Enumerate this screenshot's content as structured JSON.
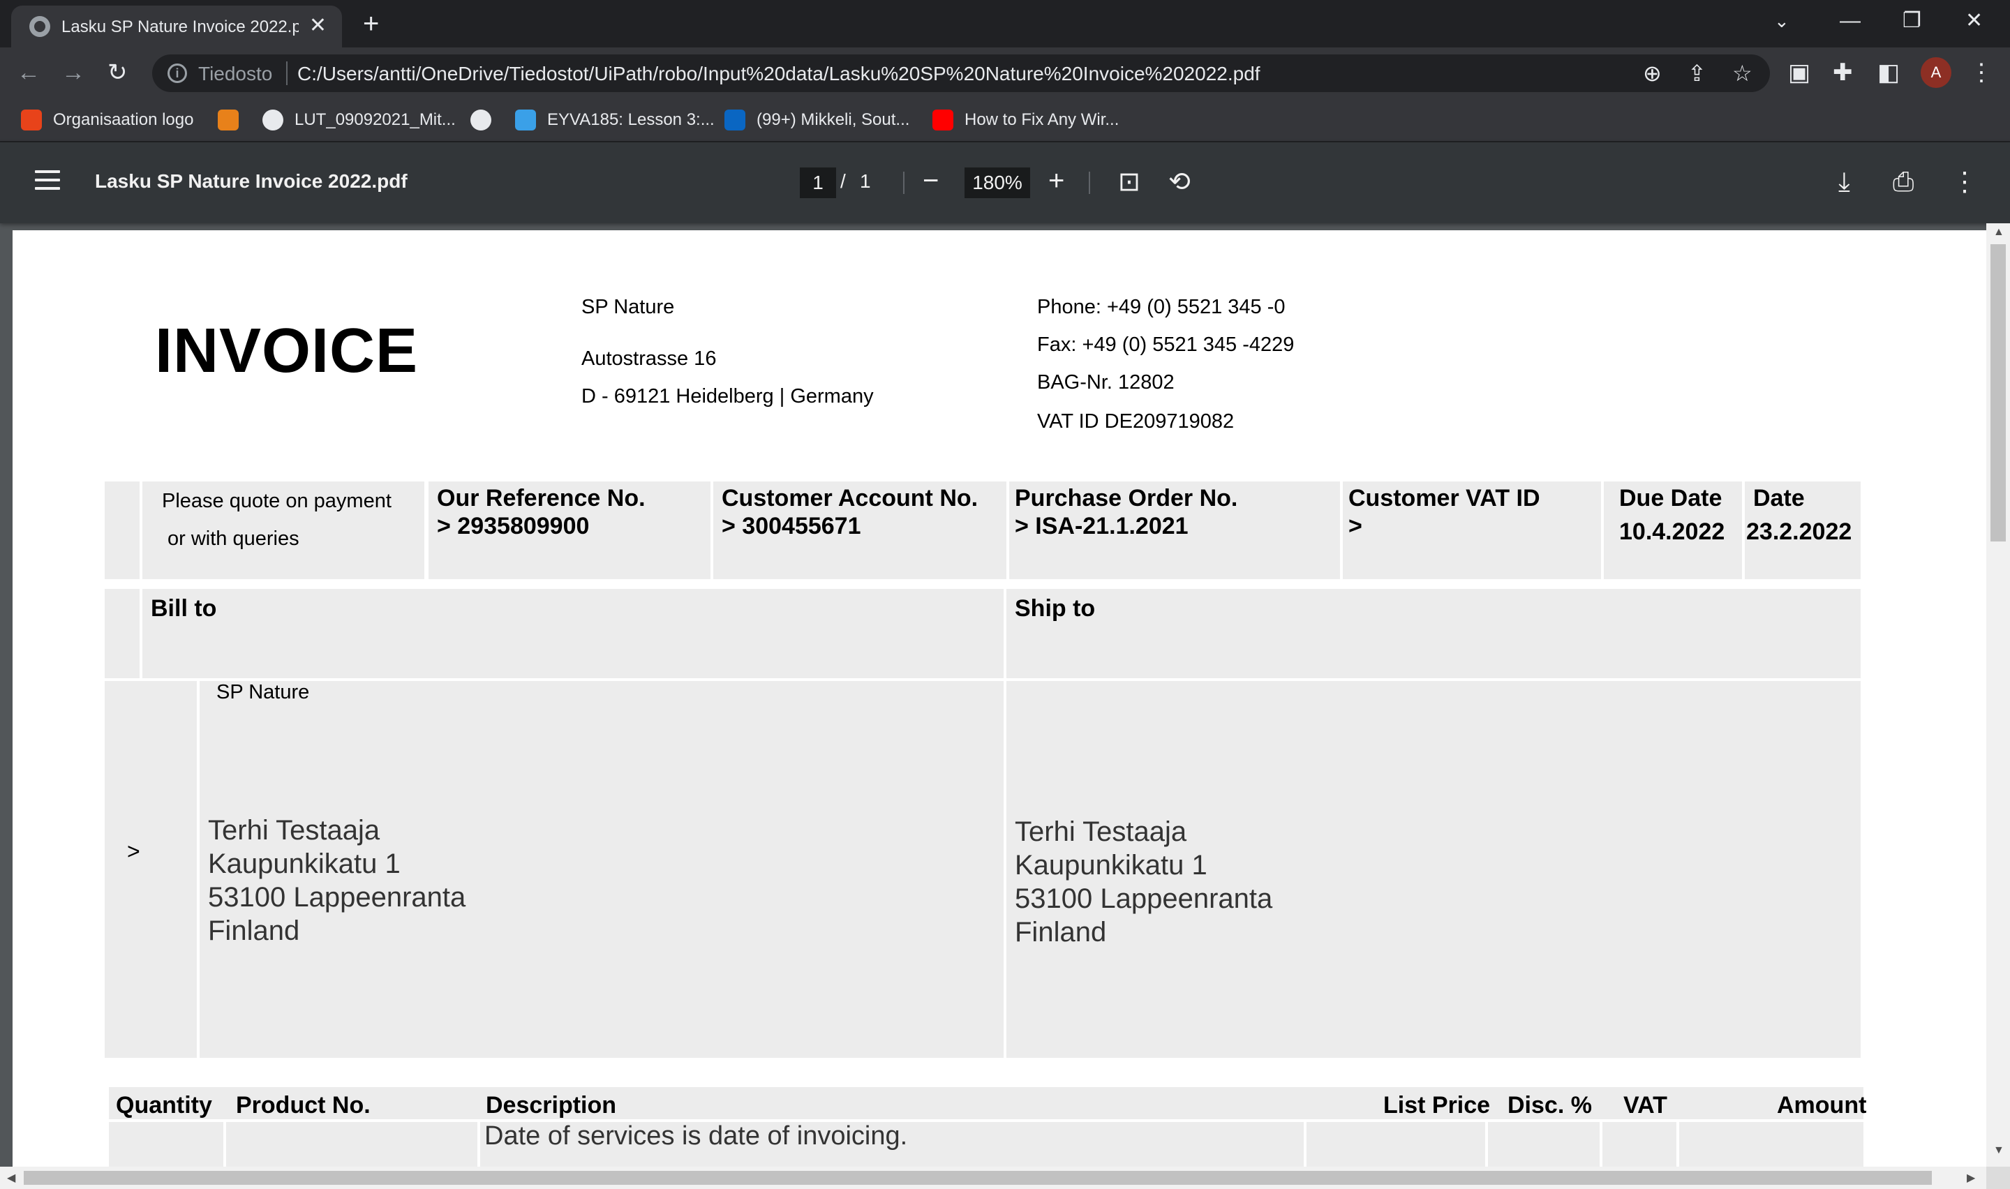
{
  "browser": {
    "tab_title": "Lasku SP Nature Invoice 2022.pdf",
    "tab_close": "✕",
    "new_tab": "+",
    "minimize": "—",
    "restore": "❐",
    "close": "✕",
    "back": "←",
    "forward": "→",
    "reload": "↻",
    "info_glyph": "i",
    "url_scheme": "Tiedosto",
    "url": "C:/Users/antti/OneDrive/Tiedostot/UiPath/robo/Input%20data/Lasku%20SP%20Nature%20Invoice%202022.pdf",
    "avatar_initial": "A",
    "icons": [
      "zoom-icon",
      "share-icon",
      "star-icon",
      "extension-icon",
      "puzzle-icon",
      "sidepanel-icon",
      "kebab-icon"
    ]
  },
  "bookmarks": [
    {
      "label": "Organisaation logo",
      "color": "#e8431a"
    },
    {
      "label": "",
      "color": "#e8811a"
    },
    {
      "label": "LUT_09092021_Mit...",
      "color": "#e8eaed"
    },
    {
      "label": "",
      "color": "#e8eaed"
    },
    {
      "label": "EYVA185: Lesson 3:...",
      "color": "#3aa0e8"
    },
    {
      "label": "(99+) Mikkeli, Sout...",
      "color": "#0a66c2"
    },
    {
      "label": "How to Fix Any Wir...",
      "color": "#ff0000"
    }
  ],
  "pdf_toolbar": {
    "title": "Lasku SP Nature Invoice 2022.pdf",
    "page_current": "1",
    "page_sep": "/",
    "page_total": "1",
    "zoom_out": "−",
    "zoom": "180%",
    "zoom_in": "+",
    "fit_icon": "⊡",
    "rotate_icon": "⟲",
    "download_icon": "⤓",
    "print_icon": "⎙",
    "more_icon": "⋮"
  },
  "invoice": {
    "title": "INVOICE",
    "company": {
      "name": "SP Nature",
      "street": "Autostrasse 16",
      "city": "D - 69121 Heidelberg | Germany"
    },
    "contact": {
      "phone": "Phone: +49 (0) 5521 345 -0",
      "fax": "Fax: +49 (0) 5521 345 -4229",
      "bag": "BAG-Nr. 12802",
      "vat": "VAT ID DE209719082"
    },
    "reference_row": {
      "quote_line1": "Please quote on payment",
      "quote_line2": "or with queries",
      "our_ref_label": "Our Reference No.",
      "our_ref_value": "> 2935809900",
      "cust_account_label": "Customer Account No.",
      "cust_account_value": "> 300455671",
      "po_label": "Purchase Order No.",
      "po_value": "> ISA-21.1.2021",
      "cust_vat_label": "Customer VAT ID",
      "cust_vat_value": ">",
      "due_label": "Due Date",
      "due_value": "10.4.2022",
      "date_label": "Date",
      "date_value": "23.2.2022"
    },
    "bill_to_label": "Bill to",
    "ship_to_label": "Ship to",
    "bill_to": {
      "marker": ">",
      "company": "SP Nature",
      "name": "Terhi Testaaja",
      "street": "Kaupunkikatu 1",
      "city": "53100 Lappeenranta",
      "country": "Finland"
    },
    "ship_to": {
      "name": "Terhi Testaaja",
      "street": "Kaupunkikatu 1",
      "city": "53100 Lappeenranta",
      "country": "Finland"
    },
    "items": {
      "headers": [
        "Quantity",
        "Product No.",
        "Description",
        "List Price",
        "Disc. %",
        "VAT",
        "Amount"
      ],
      "first_row_description": "Date of services is date of invoicing."
    }
  }
}
